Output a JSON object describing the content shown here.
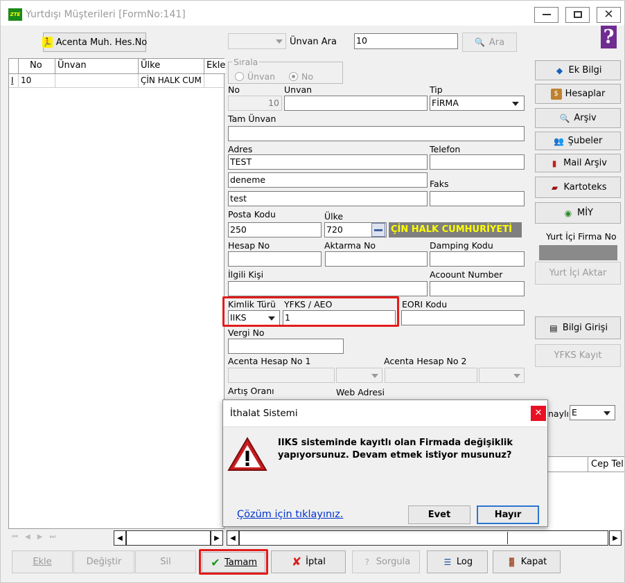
{
  "window": {
    "title": "Yurtdışı Müşterileri [FormNo:141]",
    "app_logo_text": "ZTE",
    "minimize_icon": "minimize-icon",
    "maximize_icon": "maximize-icon",
    "close_icon": "close-icon"
  },
  "toolbar": {
    "acenta_button": "Acenta Muh. Hes.No",
    "search_label": "Ünvan Ara",
    "search_value": "10",
    "search_button": "Ara",
    "help_icon": "?"
  },
  "grid": {
    "columns": [
      "No",
      "Ünvan",
      "Ülke",
      "Ekle"
    ],
    "rows": [
      {
        "marker": "I",
        "no": "10",
        "unvan": "",
        "ulke": "ÇİN HALK CUM",
        "ekle": ""
      }
    ]
  },
  "form": {
    "sirala_legend": "Sırala",
    "sirala_options": [
      "Ünvan",
      "No"
    ],
    "sirala_selected": "No",
    "no_label": "No",
    "no_value": "10",
    "unvan_label": "Unvan",
    "unvan_value": "",
    "tip_label": "Tip",
    "tip_value": "FİRMA",
    "tam_unvan_label": "Tam Ünvan",
    "tam_unvan_value": "",
    "adres_label": "Adres",
    "adres_lines": [
      "TEST",
      "deneme",
      "test"
    ],
    "telefon_label": "Telefon",
    "telefon_value": "",
    "faks_label": "Faks",
    "faks_value": "",
    "posta_kodu_label": "Posta Kodu",
    "posta_kodu_value": "250",
    "ulke_label": "Ülke",
    "ulke_code": "720",
    "ulke_name": "ÇİN HALK CUMHURİYETİ",
    "hesap_no_label": "Hesap No",
    "aktarma_no_label": "Aktarma No",
    "damping_kodu_label": "Damping Kodu",
    "ilgili_kisi_label": "İlgili Kişi",
    "account_number_label": "Acoount Number",
    "kimlik_turu_label": "Kimlik Türü",
    "kimlik_turu_value": "IIKS",
    "yfks_label": "YFKS / AEO",
    "yfks_value": "1",
    "eori_label": "EORI Kodu",
    "vergi_no_label": "Vergi No",
    "acenta_hesap_1_label": "Acenta Hesap No 1",
    "acenta_hesap_2_label": "Acenta Hesap No 2",
    "artis_orani_label": "Artış Oranı",
    "web_adresi_label": "Web Adresi",
    "onayli_label": "naylı",
    "onayli_value": "E",
    "cep_tel_header": "Cep Tel"
  },
  "side_buttons": {
    "ek_bilgi": "Ek Bilgi",
    "hesaplar": "Hesaplar",
    "arsiv": "Arşiv",
    "subeler": "Şubeler",
    "mail_arsiv": "Mail Arşiv",
    "kartoteks": "Kartoteks",
    "miy": "MİY",
    "yurt_ici_firma_no_label": "Yurt İçi Firma No",
    "yurt_ici_aktar": "Yurt İçi Aktar",
    "bilgi_girisi": "Bilgi Girişi",
    "yfks_kayit": "YFKS Kayıt"
  },
  "bottom_buttons": {
    "ekle": "Ekle",
    "degistir": "Değiştir",
    "sil": "Sil",
    "tamam": "Tamam",
    "iptal": "İptal",
    "sorgula": "Sorgula",
    "log": "Log",
    "kapat": "Kapat"
  },
  "dialog": {
    "title": "İthalat Sistemi",
    "message_line1": "IIKS sisteminde kayıtlı olan Firmada değişiklik",
    "message_line2": "yapıyorsunuz. Devam etmek istiyor musunuz?",
    "help_link": "Çözüm için tıklayınız.",
    "yes_button": "Evet",
    "no_button": "Hayır",
    "warning_icon": "warning-icon"
  },
  "colors": {
    "highlight_red": "#e31b1b",
    "country_bg": "#7f7f7f",
    "country_text": "#ffff00",
    "link_blue": "#0033cc",
    "dialog_close_bg": "#e81123"
  }
}
